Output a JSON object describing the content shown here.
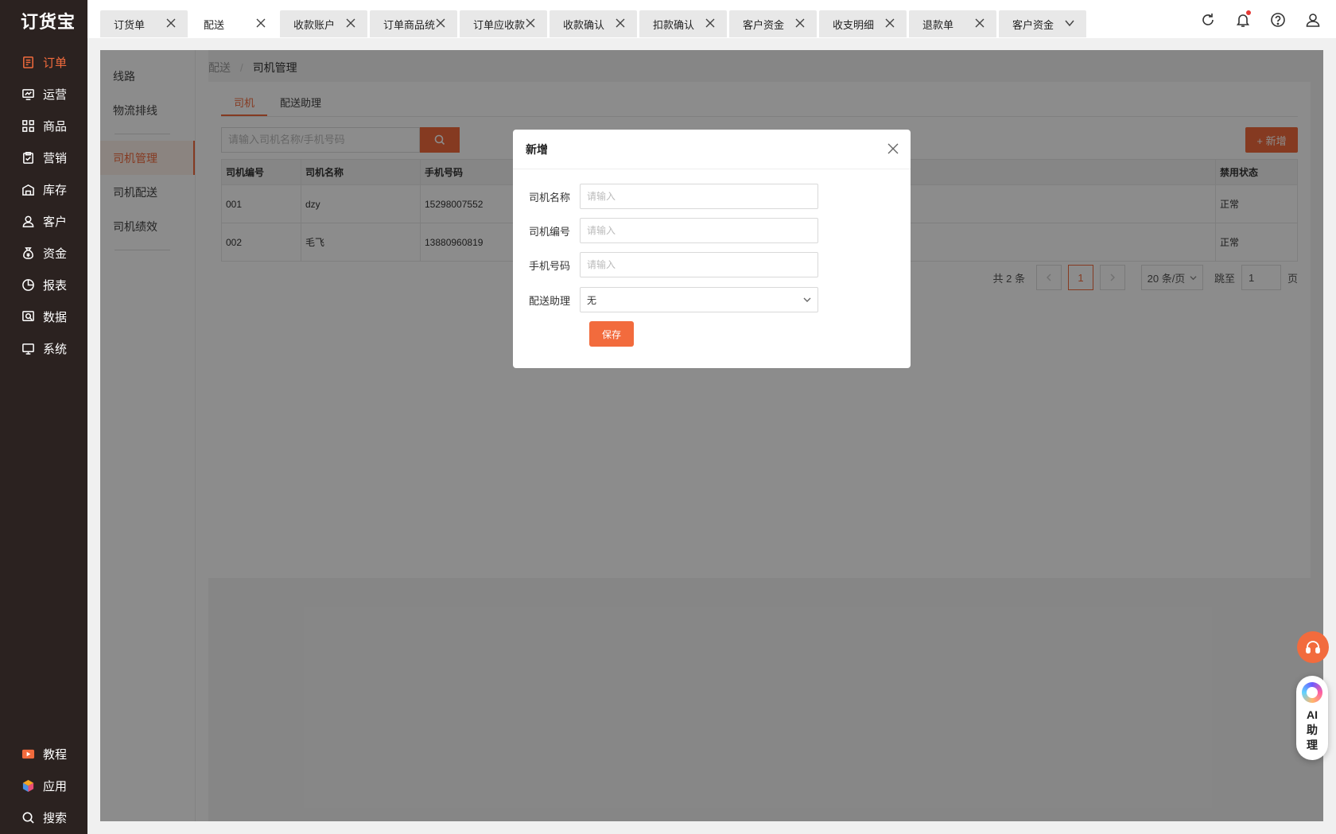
{
  "app": {
    "logo": "订货宝"
  },
  "sidebar": {
    "items": [
      {
        "label": "订单",
        "icon": "order-icon",
        "active": true
      },
      {
        "label": "运营",
        "icon": "operation-chart-icon"
      },
      {
        "label": "商品",
        "icon": "grid-apps-icon"
      },
      {
        "label": "营销",
        "icon": "clipboard-check-icon"
      },
      {
        "label": "库存",
        "icon": "warehouse-icon"
      },
      {
        "label": "客户",
        "icon": "user-icon"
      },
      {
        "label": "资金",
        "icon": "money-bag-icon"
      },
      {
        "label": "报表",
        "icon": "pie-chart-icon"
      },
      {
        "label": "数据",
        "icon": "data-search-icon"
      },
      {
        "label": "系统",
        "icon": "monitor-icon"
      }
    ],
    "bottom": [
      {
        "label": "教程",
        "icon": "video-play-icon"
      },
      {
        "label": "应用",
        "icon": "cube-apps-icon"
      },
      {
        "label": "搜索",
        "icon": "search-icon"
      }
    ]
  },
  "tabs": [
    {
      "label": "订货单"
    },
    {
      "label": "配送",
      "active": true
    },
    {
      "label": "收款账户"
    },
    {
      "label": "订单商品统"
    },
    {
      "label": "订单应收款"
    },
    {
      "label": "收款确认"
    },
    {
      "label": "扣款确认"
    },
    {
      "label": "客户资金"
    },
    {
      "label": "收支明细"
    },
    {
      "label": "退款单"
    },
    {
      "label": "客户资金"
    }
  ],
  "subnav": {
    "items": [
      {
        "label": "线路"
      },
      {
        "label": "物流排线"
      },
      {
        "label": "司机管理",
        "active": true
      },
      {
        "label": "司机配送"
      },
      {
        "label": "司机绩效"
      }
    ]
  },
  "breadcrumb": {
    "parent": "配送",
    "separator": "/",
    "current": "司机管理"
  },
  "subtabs": [
    {
      "label": "司机",
      "active": true
    },
    {
      "label": "配送助理"
    }
  ],
  "search": {
    "placeholder": "请输入司机名称/手机号码"
  },
  "toolbar": {
    "add_label": "+ 新增"
  },
  "table": {
    "headers": [
      "司机编号",
      "司机名称",
      "手机号码",
      "禁用状态"
    ],
    "rows": [
      {
        "code": "001",
        "name": "dzy",
        "phone": "15298007552",
        "status": "正常"
      },
      {
        "code": "002",
        "name": "毛飞",
        "phone": "13880960819",
        "status": "正常"
      }
    ]
  },
  "pagination": {
    "total": "共 2 条",
    "current": "1",
    "page_size": "20 条/页",
    "jump_label": "跳至",
    "jump_value": "1",
    "page_suffix": "页"
  },
  "modal": {
    "title": "新增",
    "fields": [
      {
        "label": "司机名称",
        "placeholder": "请输入",
        "value": ""
      },
      {
        "label": "司机编号",
        "placeholder": "请输入",
        "value": ""
      },
      {
        "label": "手机号码",
        "placeholder": "请输入",
        "value": ""
      }
    ],
    "assistant": {
      "label": "配送助理",
      "value": "无"
    },
    "save_label": "保存"
  },
  "ai_assistant": {
    "label": "AI助理"
  },
  "colors": {
    "accent": "#f26b3d",
    "sidebar_bg": "#2b2220"
  }
}
